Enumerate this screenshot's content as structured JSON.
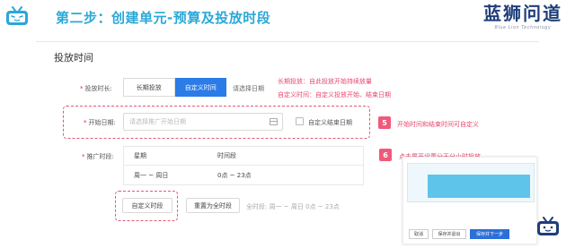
{
  "header": {
    "title": "第二步：创建单元-预算及投放时段",
    "brand_name": "蓝狮问道",
    "brand_sub": "Blue Lion Technology"
  },
  "form": {
    "section_title": "投放时间",
    "duration": {
      "label": "投放时长:",
      "options": [
        "长期投放",
        "自定义时间"
      ],
      "selected": "自定义时间",
      "hint": "请选择日期"
    },
    "start_date": {
      "label": "开始日期:",
      "placeholder": "请选择推广开始日期",
      "custom_end_label": "自定义结束日期"
    },
    "schedule": {
      "label": "推广时段:",
      "columns": [
        "星期",
        "时间段"
      ],
      "rows": [
        [
          "周一 ~ 周日",
          "0点 ~ 23点"
        ]
      ],
      "custom_button": "自定义时段",
      "reset_button": "重置为全时段",
      "full_time_text": "全时段:  周一 ~ 周日 0点 ~ 23点"
    }
  },
  "annotations": {
    "long_term": "长期投放：自此投放开始持续放量",
    "custom_time": "自定义时间：自定义投放开始、结束日期",
    "step5_number": "5",
    "step5_text": "开始时间和结束时间可自定义",
    "step6_number": "6",
    "step6_text": "点击展开设置分天分小时投放"
  },
  "thumbnail": {
    "buttons": [
      "取消",
      "保存并退出",
      "保存并下一步"
    ]
  },
  "colors": {
    "accent_blue": "#2b7be8",
    "title_blue": "#2aa8d8",
    "annotation_pink": "#e8466e",
    "brand_navy": "#1f3e7a"
  }
}
